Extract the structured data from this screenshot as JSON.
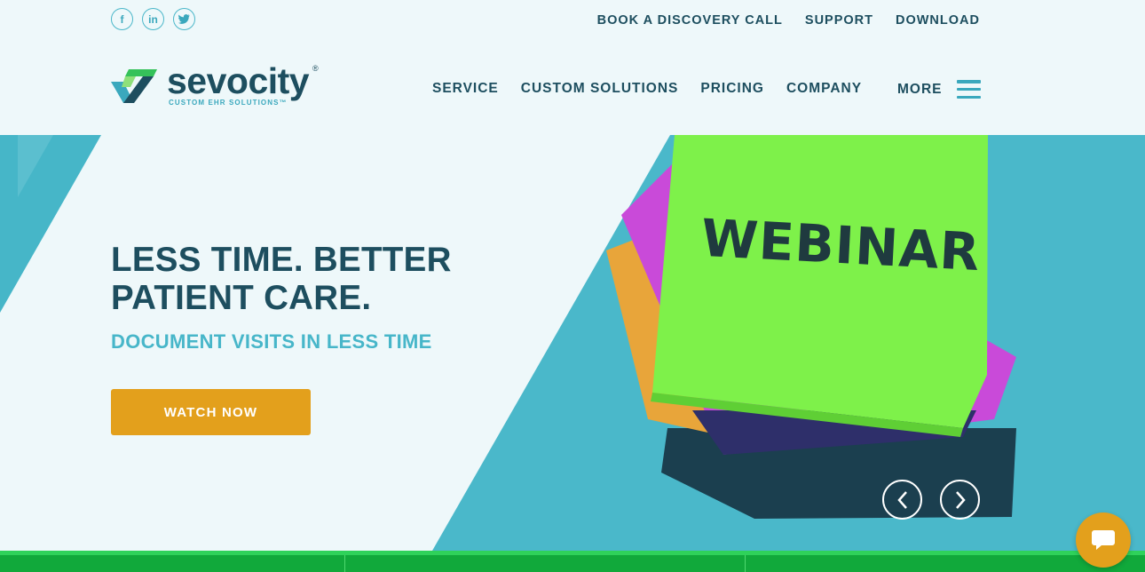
{
  "social": {
    "facebook_label": "f",
    "linkedin_label": "in",
    "twitter_label": "t"
  },
  "utility_nav": {
    "items": [
      "BOOK A DISCOVERY CALL",
      "SUPPORT",
      "DOWNLOAD"
    ]
  },
  "brand": {
    "name": "sevocity",
    "reg": "®",
    "tagline": "CUSTOM EHR SOLUTIONS™"
  },
  "main_nav": {
    "items": [
      "SERVICE",
      "CUSTOM SOLUTIONS",
      "PRICING",
      "COMPANY"
    ],
    "more_label": "MORE"
  },
  "hero": {
    "title_line1": "LESS TIME. BETTER",
    "title_line2": "PATIENT CARE.",
    "subtitle": "DOCUMENT VISITS IN LESS TIME",
    "cta_label": "WATCH NOW",
    "note_text": "WEBINAR"
  },
  "icons": {
    "social": [
      "facebook-icon",
      "linkedin-icon",
      "twitter-icon"
    ],
    "menu": "hamburger-icon",
    "carousel": [
      "chevron-left-icon",
      "chevron-right-icon"
    ],
    "chat": "chat-bubble-icon"
  },
  "colors": {
    "navy": "#1d4e5f",
    "teal": "#47b6c9",
    "orange": "#e3a01c",
    "green": "#11a93b",
    "note_green": "#7ef14a",
    "background": "#eef8fa"
  }
}
